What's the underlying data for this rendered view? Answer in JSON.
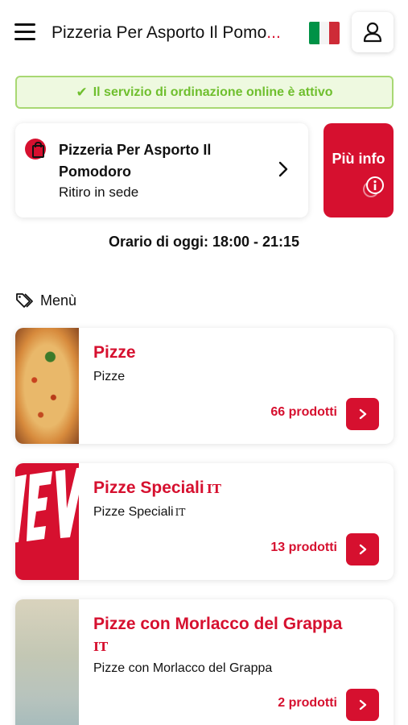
{
  "header": {
    "title": "Pizzeria Per Asporto Il Pomo",
    "title_ellipsis": "...",
    "flag_colors": [
      "#009246",
      "#ffffff",
      "#ce2b37"
    ]
  },
  "status": {
    "text": "Il servizio di ordinazione online è attivo",
    "color": "#6fbf2e"
  },
  "shop": {
    "name": "Pizzeria Per Asporto Il Pomodoro",
    "mode": "Ritiro in sede",
    "info_button": "Più info"
  },
  "hours": {
    "text": "Orario di oggi: 18:00 - 21:15"
  },
  "menu": {
    "heading": "Menù",
    "categories": [
      {
        "title": "Pizze",
        "title_badge": "",
        "description": "Pizze",
        "description_badge": "",
        "count": "66 prodotti",
        "image": "pizza-photo"
      },
      {
        "title": "Pizze Speciali",
        "title_badge": "IT",
        "description": "Pizze Speciali",
        "description_badge": "IT",
        "count": "13 prodotti",
        "image": "nev-logo-photo"
      },
      {
        "title": "Pizze con Morlacco del Grappa",
        "title_badge": "IT",
        "description": "Pizze con Morlacco del Grappa",
        "description_badge": "",
        "count": "2 prodotti",
        "image": "morlacco-pizza-photo"
      }
    ]
  },
  "colors": {
    "accent": "#d6102f",
    "status_border": "#a8d873",
    "status_bg": "#eef9e0"
  }
}
